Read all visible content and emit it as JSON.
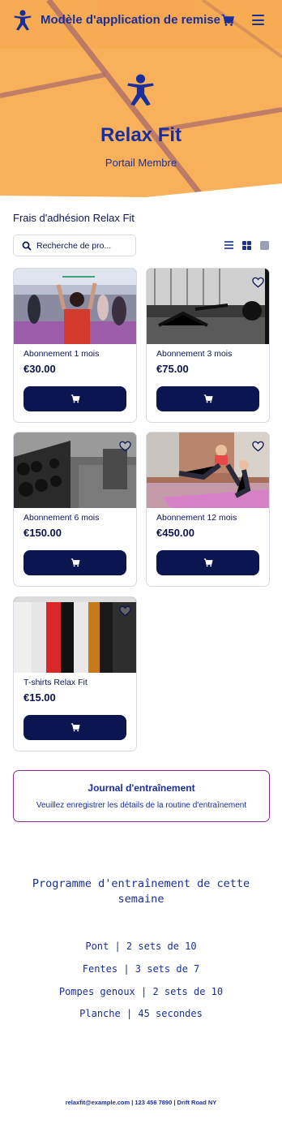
{
  "header": {
    "app_title": "Modèle d'application de remise ...",
    "brand_name": "Relax Fit",
    "brand_subtitle": "Portail Membre"
  },
  "catalog": {
    "section_title": "Frais d'adhésion Relax Fit",
    "search_placeholder": "Recherche de pro...",
    "products": [
      {
        "name": "Abonnement 1 mois",
        "price": "€30.00"
      },
      {
        "name": "Abonnement 3 mois",
        "price": "€75.00"
      },
      {
        "name": "Abonnement 6 mois",
        "price": "€150.00"
      },
      {
        "name": "Abonnement 12 mois",
        "price": "€450.00"
      },
      {
        "name": "T-shirts Relax Fit",
        "price": "€15.00"
      }
    ]
  },
  "journal": {
    "title": "Journal d'entraînement",
    "subtitle": "Veuillez enregistrer les détails de la routine d'entraînement"
  },
  "program": {
    "title": "Programme d'entraînement de cette semaine",
    "items": [
      "Pont | 2 sets de 10",
      "Fentes | 3 sets de 7",
      "Pompes genoux | 2 sets de 10",
      "Planche | 45 secondes"
    ]
  },
  "footer": {
    "contact": "relaxfit@example.com | 123 456 7890 | Drift Road NY"
  },
  "colors": {
    "primary": "#1a2e9c",
    "navy": "#0b1550",
    "hero": "#f8b05a",
    "journal_border": "#8a2d8f"
  },
  "icons": [
    "person-logo-icon",
    "cart-icon",
    "menu-icon",
    "search-icon",
    "list-view-icon",
    "grid-view-icon",
    "single-view-icon",
    "heart-icon"
  ]
}
